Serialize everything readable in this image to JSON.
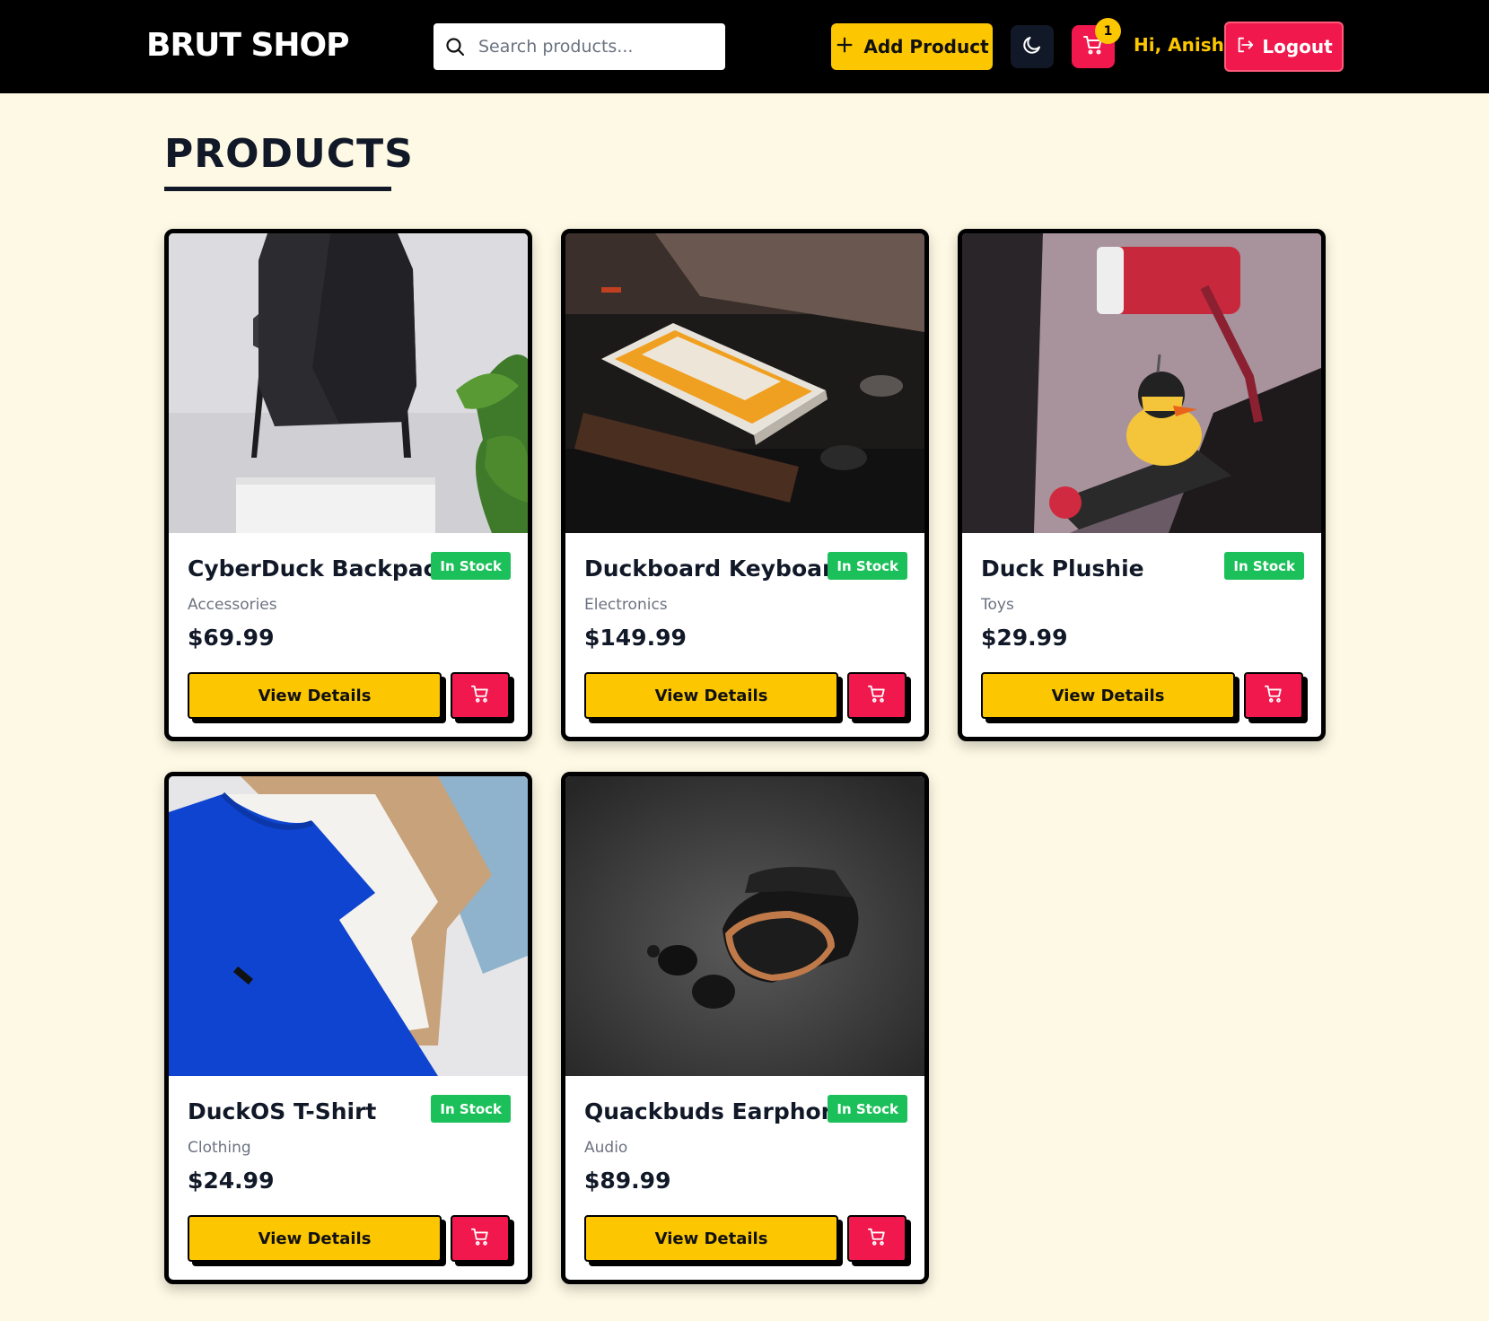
{
  "header": {
    "logo": "BRUT SHOP",
    "search_placeholder": "Search products...",
    "add_product_label": "Add Product",
    "cart_count": "1",
    "greeting": "Hi, Anish",
    "logout_label": "Logout"
  },
  "page": {
    "title": "PRODUCTS"
  },
  "products": [
    {
      "name": "CyberDuck Backpack",
      "stock": "In Stock",
      "category": "Accessories",
      "price": "$69.99",
      "view_label": "View Details",
      "image": "backpack"
    },
    {
      "name": "Duckboard Keyboard",
      "stock": "In Stock",
      "category": "Electronics",
      "price": "$149.99",
      "view_label": "View Details",
      "image": "keyboard"
    },
    {
      "name": "Duck Plushie",
      "stock": "In Stock",
      "category": "Toys",
      "price": "$29.99",
      "view_label": "View Details",
      "image": "duck-on-motorcycle"
    },
    {
      "name": "DuckOS T-Shirt",
      "stock": "In Stock",
      "category": "Clothing",
      "price": "$24.99",
      "view_label": "View Details",
      "image": "tshirts"
    },
    {
      "name": "Quackbuds Earphones",
      "stock": "In Stock",
      "category": "Audio",
      "price": "$89.99",
      "view_label": "View Details",
      "image": "earbuds"
    }
  ],
  "colors": {
    "accent_yellow": "#fcc600",
    "accent_red": "#f0184d",
    "stock_green": "#1cc05a",
    "background": "#fdf9e4",
    "navbar": "#000000"
  },
  "icons": [
    "search-icon",
    "plus-icon",
    "moon-icon",
    "cart-icon",
    "logout-icon"
  ]
}
